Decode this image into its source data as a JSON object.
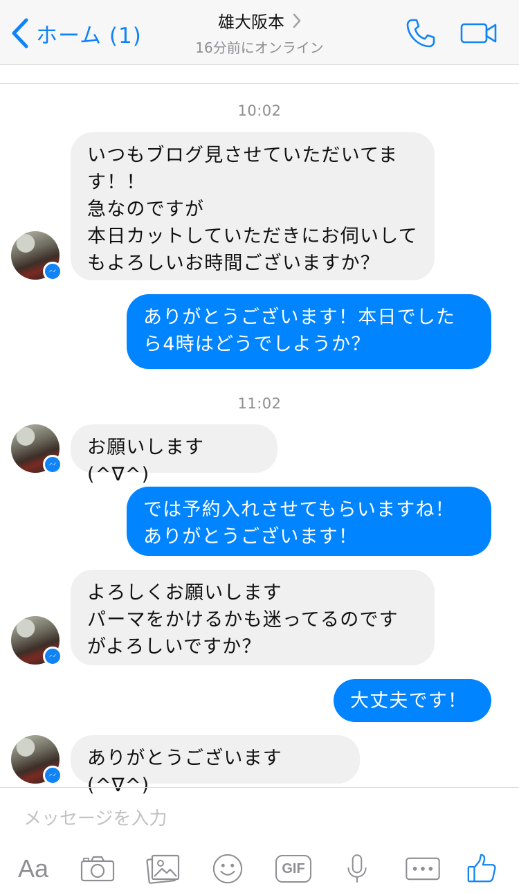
{
  "header": {
    "back_label": "ホーム (1)",
    "title": "雄大阪本",
    "subtitle": "16分前にオンライン"
  },
  "messages": [
    {
      "type": "timestamp",
      "text": "10:02"
    },
    {
      "type": "incoming",
      "text": "いつもブログ見させていただいてます！！\n急なのですが\n本日カットしていただきにお伺いしてもよろしいお時間ございますか？"
    },
    {
      "type": "outgoing",
      "text": "ありがとうございます！本日でしたら4時はどうでしようか？"
    },
    {
      "type": "timestamp",
      "text": "11:02"
    },
    {
      "type": "incoming",
      "text": "お願いします(^∇^)"
    },
    {
      "type": "outgoing",
      "text": "では予約入れさせてもらいますね！\nありがとうございます！"
    },
    {
      "type": "incoming",
      "text": "よろしくお願いします\nパーマをかけるかも迷ってるのですがよろしいですか？"
    },
    {
      "type": "outgoing",
      "text": "大丈夫です！"
    },
    {
      "type": "incoming",
      "text": "ありがとうございます(^∇^)"
    }
  ],
  "composer": {
    "placeholder": "メッセージを入力",
    "text_tool_label": "Aa",
    "gif_label": "GIF"
  },
  "colors": {
    "accent": "#1083f6",
    "outgoing_bubble": "#0084ff",
    "incoming_bubble": "#f1f0f0"
  },
  "icons": [
    "chevron-left-icon",
    "chevron-right-icon",
    "phone-icon",
    "video-camera-icon",
    "messenger-badge-icon",
    "camera-icon",
    "photo-icon",
    "emoji-icon",
    "gif-icon",
    "microphone-icon",
    "more-icon",
    "thumbs-up-icon"
  ]
}
